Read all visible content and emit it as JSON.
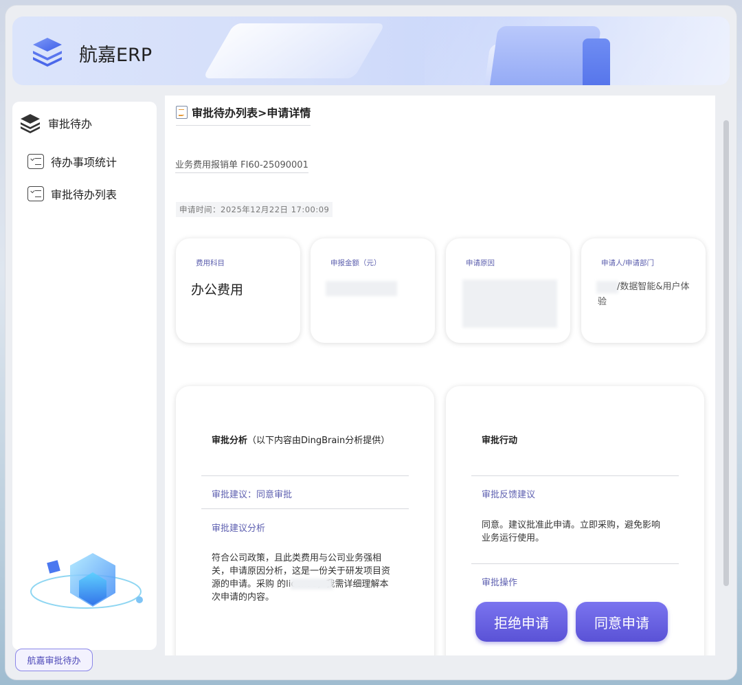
{
  "app": {
    "title": "航嘉ERP"
  },
  "sidebar": {
    "header": "审批待办",
    "items": [
      {
        "label": "待办事项统计"
      },
      {
        "label": "审批待办列表"
      }
    ],
    "footer_button": "航嘉审批待办"
  },
  "main": {
    "breadcrumb": "审批待办列表>申请详情",
    "doc_number": "业务费用报销单 FI60-25090001",
    "apply_time": "申请时间：2025年12月22日 17:00:09",
    "cards": [
      {
        "label": "费用科目",
        "value": "办公费用"
      },
      {
        "label": "申报金额（元）",
        "value": ""
      },
      {
        "label": "申请原因",
        "value": ""
      },
      {
        "label": "申请人/申请部门",
        "value": "/数据智能&用户体验"
      }
    ],
    "analysis": {
      "title": "审批分析",
      "title_note": "（以下内容由DingBrain分析提供）",
      "suggestion": "审批建议：同意审批",
      "analysis_head": "审批建议分析",
      "analysis_body": "符合公司政策，且此类费用与公司业务强相关，申请原因分析，这是一份关于研发项目资源的申请。采购         的license，我需详细理解本次申请的内容。"
    },
    "action": {
      "title": "审批行动",
      "feedback_head": "审批反馈建议",
      "feedback_body": "同意。建议批准此申请。立即采购，避免影响业务运行使用。",
      "operation_head": "审批操作",
      "reject_label": "拒绝申请",
      "approve_label": "同意申请"
    }
  },
  "colors": {
    "accent": "#5d5fb0",
    "button": "#6a63e3"
  }
}
